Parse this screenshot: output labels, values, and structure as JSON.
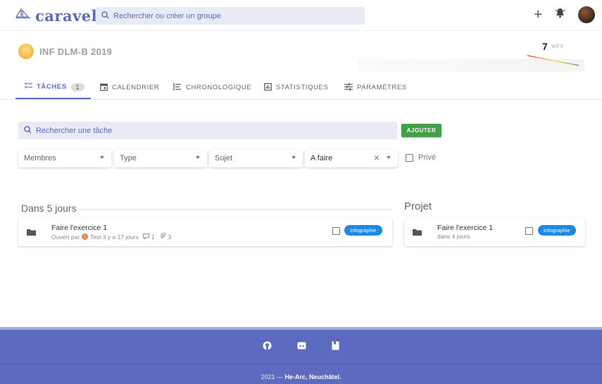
{
  "app": {
    "logo_text": "caravel"
  },
  "header": {
    "search_placeholder": "Rechercher ou créer un groupe",
    "plus_label": "+"
  },
  "group": {
    "name": "INF DLM-B 2019",
    "week_number": "7",
    "week_label": "WES"
  },
  "tabs": [
    {
      "label": "TÂCHES",
      "badge": "1",
      "icon": "task-list-icon",
      "active": true
    },
    {
      "label": "CALENDRIER",
      "icon": "calendar-icon"
    },
    {
      "label": "CHRONOLOGIQUE",
      "icon": "timeline-icon"
    },
    {
      "label": "STATISTIQUES",
      "icon": "chart-icon"
    },
    {
      "label": "PARAMÈTRES",
      "icon": "settings-sliders-icon"
    }
  ],
  "tasks_toolbar": {
    "search_placeholder": "Rechercher une tâche",
    "add_label": "AJOUTER"
  },
  "filters": {
    "members": "Membres",
    "type": "Type",
    "subject": "Sujet",
    "status": "A faire",
    "private_label": "Privé"
  },
  "sections": {
    "upcoming": {
      "title": "Dans 5 jours",
      "task": {
        "title": "Faire l'exercice 1",
        "opened_by_prefix": "Ouvert par",
        "author": "Test",
        "age": "il y a 17 jours",
        "comments": "1",
        "attachments": "3",
        "tag": "Infographie"
      }
    },
    "project": {
      "title": "Projet",
      "task": {
        "title": "Faire l'exercice 1",
        "due": "dans 4 jours",
        "tag": "Infographie"
      }
    }
  },
  "footer": {
    "year_prefix": "2021 —",
    "org": "He-Arc, Neuchâtel."
  },
  "colors": {
    "primary": "#5c6bc0",
    "primary_light": "#e8eaf6",
    "success": "#43a047",
    "tag": "#1e88e5"
  }
}
